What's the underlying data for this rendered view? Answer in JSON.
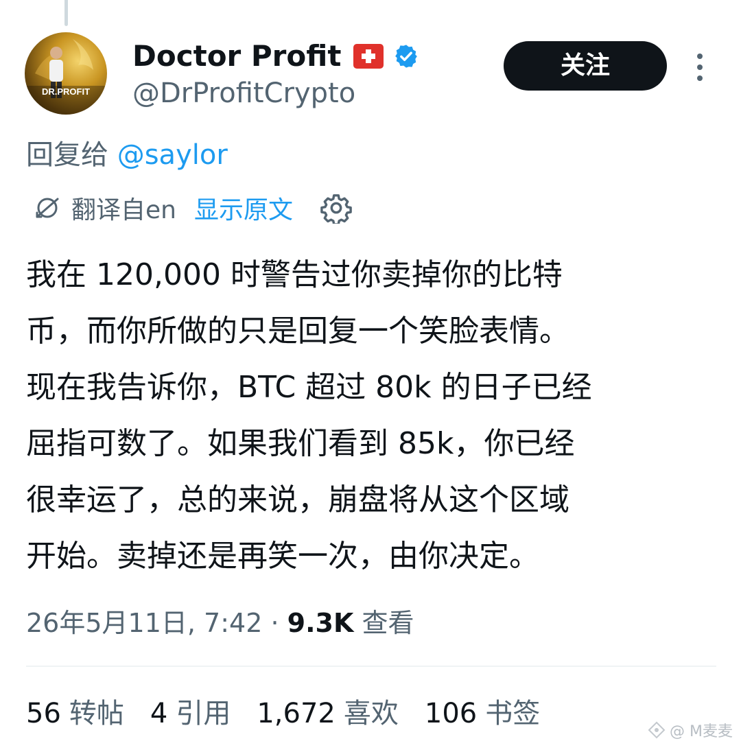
{
  "author": {
    "display_name": "Doctor Profit",
    "handle": "@DrProfitCrypto",
    "avatar_text": "DR.PROFIT",
    "flag": "swiss-flag-icon",
    "verified": "verified-badge-icon"
  },
  "follow_button": {
    "label": "关注"
  },
  "more_menu": {
    "icon": "more-vertical-icon"
  },
  "reply_to": {
    "prefix": "回复给",
    "mention": "@saylor"
  },
  "translation": {
    "translated_from": "翻译自en",
    "show_original": "显示原文",
    "settings_icon": "gear-icon"
  },
  "tweet": {
    "lines": [
      "我在 120,000 时警告过你卖掉你的比特",
      "币，而你所做的只是回复一个笑脸表情。",
      "现在我告诉你，BTC 超过 80k 的日子已经",
      "屈指可数了。如果我们看到 85k，你已经",
      "很幸运了，总的来说，崩盘将从这个区域",
      "开始。卖掉还是再笑一次，由你决定。"
    ]
  },
  "meta": {
    "timestamp": "26年5月11日, 7:42",
    "separator": "·",
    "views_count": "9.3K",
    "views_label": "查看"
  },
  "stats": {
    "retweets": {
      "count": "56",
      "label": "转帖"
    },
    "quotes": {
      "count": "4",
      "label": "引用"
    },
    "likes": {
      "count": "1,672",
      "label": "喜欢"
    },
    "bookmarks": {
      "count": "106",
      "label": "书签"
    }
  },
  "watermark": {
    "text": "@ M麦麦"
  },
  "colors": {
    "accent": "#1d9bf0",
    "text": "#0f1419",
    "secondary": "#536471",
    "button_bg": "#0f1419"
  }
}
